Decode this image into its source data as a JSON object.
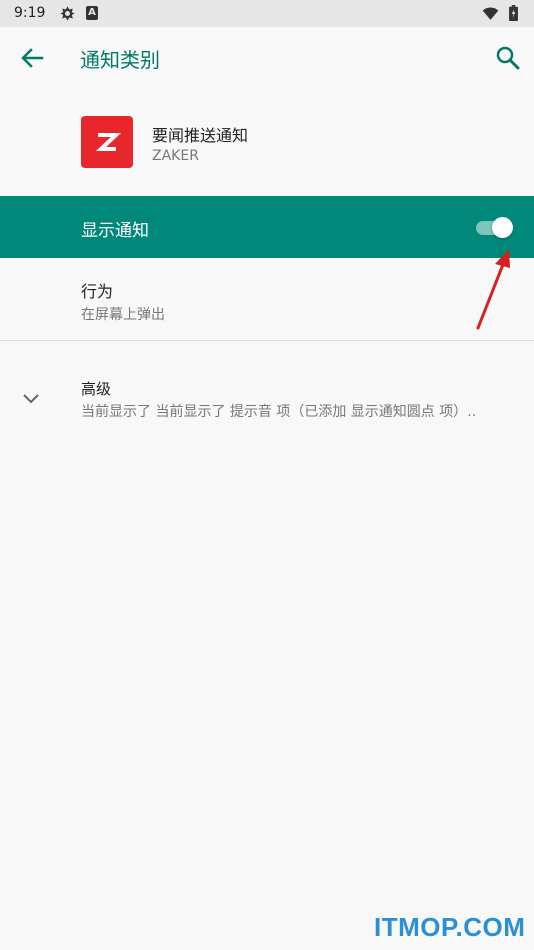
{
  "status_bar": {
    "time": "9:19",
    "icons": [
      "settings-sync-icon",
      "a-badge-icon",
      "wifi-icon",
      "battery-icon"
    ],
    "a_badge": "A"
  },
  "toolbar": {
    "title": "通知类别",
    "back_icon": "arrow-left-icon",
    "search_icon": "search-icon"
  },
  "app": {
    "channel_name": "要闻推送通知",
    "app_name": "ZAKER",
    "icon_color": "#e8262b"
  },
  "master_switch": {
    "label": "显示通知",
    "checked": true
  },
  "behavior": {
    "title": "行为",
    "summary": "在屏幕上弹出"
  },
  "advanced": {
    "title": "高级",
    "summary": "当前显示了 当前显示了 提示音 项（已添加 显示通知圆点 项）.."
  },
  "watermark": "ITMOP.COM",
  "colors": {
    "accent": "#00796b",
    "header_bg": "#00897b",
    "annotation": "#d42020"
  }
}
